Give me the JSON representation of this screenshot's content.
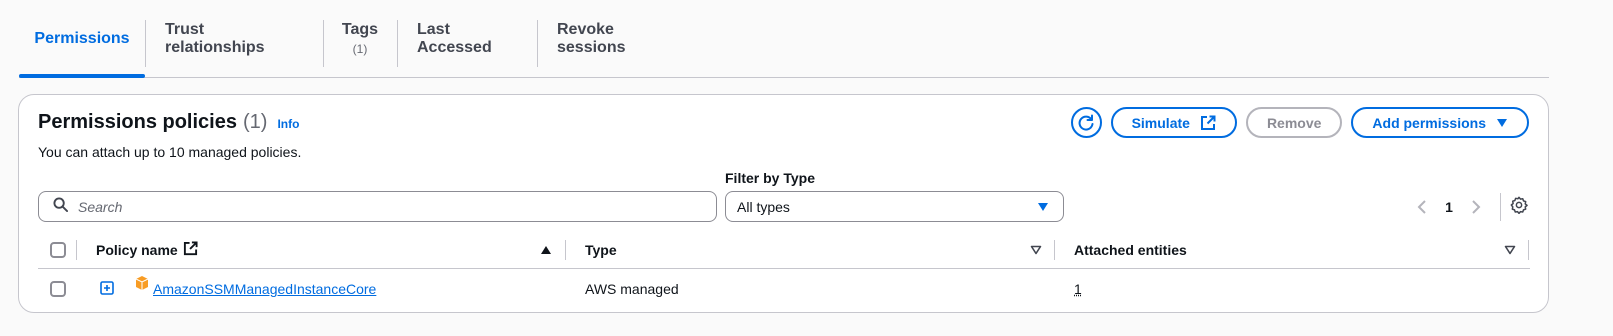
{
  "tabs": [
    {
      "label": "Permissions",
      "count": ""
    },
    {
      "label": "Trust relationships",
      "count": ""
    },
    {
      "label": "Tags",
      "count": "(1)"
    },
    {
      "label": "Last Accessed",
      "count": ""
    },
    {
      "label": "Revoke sessions",
      "count": ""
    }
  ],
  "panel": {
    "title": "Permissions policies",
    "count": "(1)",
    "info": "Info",
    "description": "You can attach up to 10 managed policies."
  },
  "actions": {
    "refresh_icon": "refresh-icon",
    "simulate": "Simulate",
    "remove": "Remove",
    "add_permissions": "Add permissions"
  },
  "search": {
    "placeholder": "Search"
  },
  "filter": {
    "label": "Filter by Type",
    "value": "All types"
  },
  "pagination": {
    "page": "1"
  },
  "table": {
    "columns": [
      "Policy name",
      "Type",
      "Attached entities"
    ],
    "rows": [
      {
        "policy_name": "AmazonSSMManagedInstanceCore",
        "type": "AWS managed",
        "attached_entities": "1"
      }
    ]
  },
  "colors": {
    "accent": "#006ce0",
    "disabled": "#8c8c94",
    "policy_icon": "#f89c24"
  }
}
